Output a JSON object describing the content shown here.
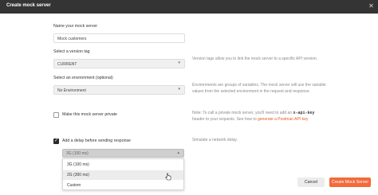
{
  "dialog": {
    "title": "Create mock server",
    "close_icon": "close-icon"
  },
  "name_field": {
    "label": "Name your mock server",
    "value": "Mock customers"
  },
  "version_field": {
    "label": "Select a version tag",
    "value": "CURRENT",
    "help": "Version tags allow you to link the mock server to a specific API version."
  },
  "environment_field": {
    "label": "Select an environment (optional)",
    "value": "No Environment",
    "help": "Environments are groups of variables. The mock server will use the variable values from the selected environment in the request and response."
  },
  "private_option": {
    "label": "Make this mock server private",
    "checked": false,
    "help_prefix": "Note: To call a private mock server, you'll need to add an",
    "help_code": "x-api-key",
    "help_middle": "header to your requests. See how to",
    "help_link": "generate a Postman API key"
  },
  "delay_option": {
    "label": "Add a delay before sending response",
    "checked": true,
    "selected": "3G (100 ms)",
    "help": "Simulate a network delay.",
    "options": [
      "3G (100 ms)",
      "2G (300 ms)",
      "Custom"
    ],
    "hovered_option": "2G (300 ms)"
  },
  "footer": {
    "cancel_label": "Cancel",
    "create_label": "Create Mock Server"
  },
  "colors": {
    "titlebar": "#343434",
    "primary_button": "#f26b3a",
    "link": "#e35d2b"
  }
}
